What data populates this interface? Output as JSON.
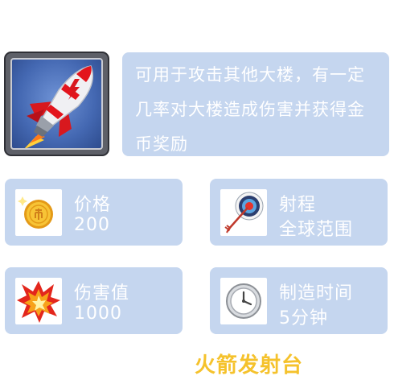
{
  "item": {
    "icon": "rocket-icon",
    "description": "可用于攻击其他大楼，有一定几率对大楼造成伤害并获得金币奖励",
    "name": "火箭发射台"
  },
  "stats": [
    {
      "icon": "coin-icon",
      "label": "价格",
      "value": "200"
    },
    {
      "icon": "target-icon",
      "label": "射程",
      "value": "全球范围"
    },
    {
      "icon": "explosion-icon",
      "label": "伤害值",
      "value": "1000"
    },
    {
      "icon": "clock-icon",
      "label": "制造时间",
      "value": "5分钟"
    }
  ],
  "colors": {
    "panel": "#c5d6ef",
    "title": "#f5c22c",
    "text": "#ffffff"
  }
}
